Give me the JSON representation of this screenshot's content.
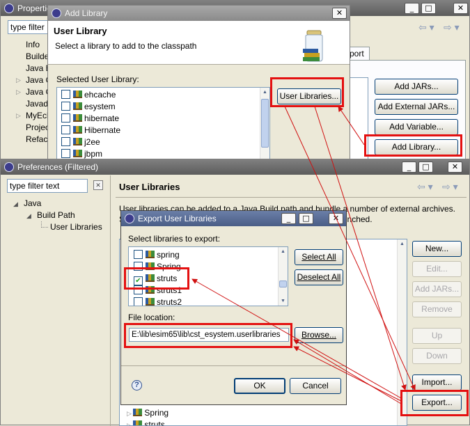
{
  "properties_window": {
    "title": "Properties for ...",
    "filter_text": "type filter",
    "tree": [
      "Info",
      "Builde",
      "Java B",
      "Java C",
      "Java C",
      "Javado",
      "MyEcli",
      "Projec",
      "Refact"
    ],
    "tab_partial": "port",
    "buttons": [
      "Add JARs...",
      "Add External JARs...",
      "Add Variable...",
      "Add Library..."
    ]
  },
  "add_library_dialog": {
    "title": "Add Library",
    "heading": "User Library",
    "description": "Select a library to add to the classpath",
    "list_label": "Selected User Library:",
    "libraries": [
      "ehcache",
      "esystem",
      "hibernate",
      "Hibernate",
      "j2ee",
      "jbpm"
    ],
    "user_libraries_button": "User Libraries..."
  },
  "preferences_window": {
    "title": "Preferences (Filtered)",
    "filter_text": "type filter text",
    "tree": [
      "Java",
      "Build Path",
      "User Libraries"
    ],
    "page_title": "User Libraries",
    "description_line1": "User libraries can be added to a Java Build path and bundle a number of external archives.",
    "description_line2": "System libraries will be added to the boot class path when launched.",
    "buttons": [
      "New...",
      "Edit...",
      "Add JARs...",
      "Remove",
      "Up",
      "Down",
      "Import...",
      "Export..."
    ],
    "list_items": [
      "Spring",
      "struts"
    ]
  },
  "export_dialog": {
    "title": "Export User Libraries",
    "select_label": "Select libraries to export:",
    "libraries": [
      {
        "name": "spring",
        "checked": false
      },
      {
        "name": "Spring",
        "checked": false
      },
      {
        "name": "struts",
        "checked": true
      },
      {
        "name": "struts1",
        "checked": false
      },
      {
        "name": "struts2",
        "checked": false
      }
    ],
    "select_all": "Select All",
    "deselect_all": "Deselect All",
    "file_location_label": "File location:",
    "file_location_value": "E:\\lib\\esim65\\lib\\cst_esystem.userlibraries",
    "browse": "Browse...",
    "ok": "OK",
    "cancel": "Cancel",
    "help": "?"
  },
  "colors": {
    "highlight": "#e41010",
    "arrow": "#d01010",
    "titlebar": "#5c5c5c"
  }
}
